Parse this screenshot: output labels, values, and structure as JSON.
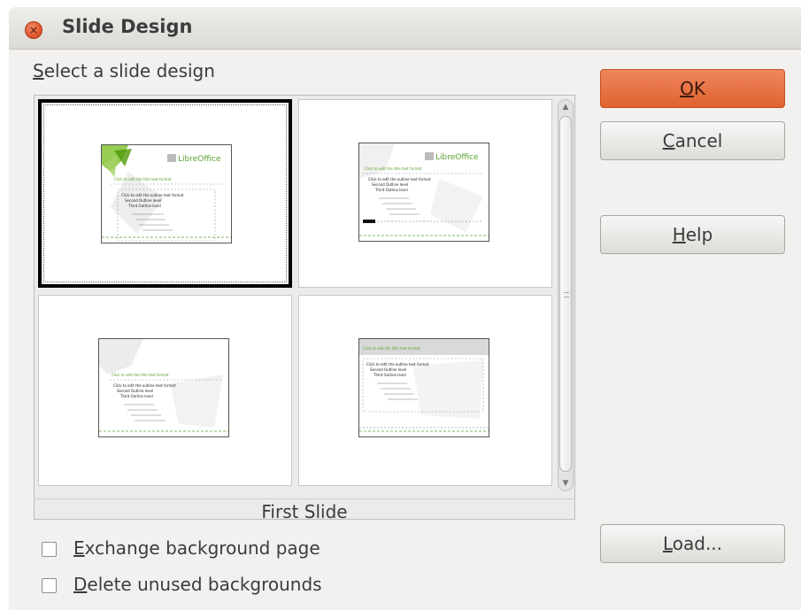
{
  "window": {
    "title": "Slide Design",
    "close_glyph": "×"
  },
  "section_label": {
    "mnemonic": "S",
    "rest": "elect a slide design"
  },
  "designs": [
    {
      "brand": "LibreOffice",
      "title_text": "Click to edit the title text format",
      "outline": [
        "Click to edit the outline text format",
        "Second Outline level",
        "Third Outline level"
      ]
    },
    {
      "brand": "LibreOffice",
      "title_text": "Click to edit the title text format",
      "outline": [
        "Click to edit the outline text format",
        "Second Outline level",
        "Third Outline level"
      ]
    },
    {
      "brand": "",
      "title_text": "Click to edit the title text format",
      "outline": [
        "Click to edit the outline text format",
        "Second Outline level",
        "Third Outline level"
      ]
    },
    {
      "brand": "",
      "title_text": "Click to edit the title text format",
      "outline": [
        "Click to edit the outline text format",
        "Second Outline level",
        "Third Outline level"
      ]
    }
  ],
  "selected_caption": "First Slide",
  "checkboxes": [
    {
      "mnemonic": "E",
      "rest": "xchange background page",
      "checked": false
    },
    {
      "mnemonic": "D",
      "rest": "elete unused backgrounds",
      "checked": false
    }
  ],
  "buttons": {
    "ok": {
      "mnemonic": "O",
      "rest": "K"
    },
    "cancel": {
      "mnemonic": "C",
      "rest": "ancel"
    },
    "help": {
      "mnemonic": "H",
      "rest": "elp"
    },
    "load": {
      "mnemonic": "L",
      "rest": "oad..."
    }
  },
  "colors": {
    "accent": "#e0622f",
    "brand_green": "#5aa02c"
  }
}
